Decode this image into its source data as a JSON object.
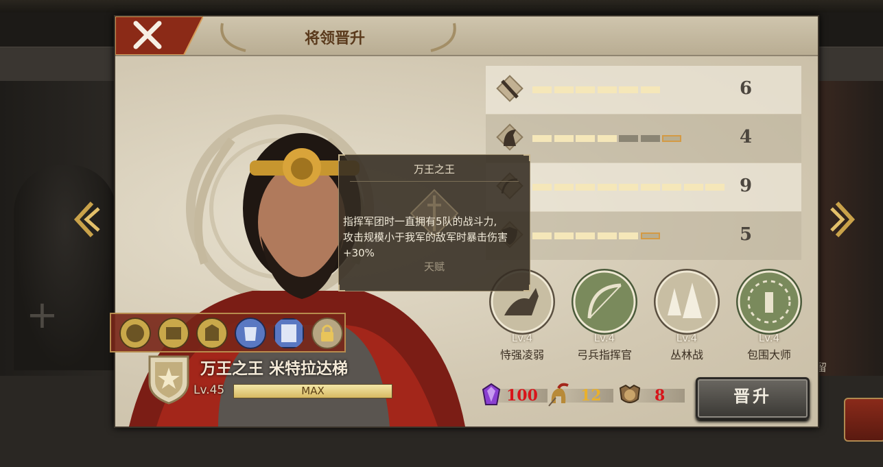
{
  "background": {
    "side_label_right": "留"
  },
  "dialog": {
    "title": "将领晋升",
    "close_icon": "close-x-icon"
  },
  "hero": {
    "name": "万王之王 米特拉达梯",
    "level": "Lv.45",
    "level_bar": "MAX",
    "rank_icon": "star-shield-icon"
  },
  "tooltip": {
    "title": "万王之王",
    "description_lines": [
      "指挥军团时一直拥有5队的战斗力,",
      "攻击规模小于我军的敌军时暴击伤害",
      "+30%"
    ],
    "footer": "天赋"
  },
  "stats": [
    {
      "icon": "sword-icon",
      "value": "6",
      "filled": 6,
      "max": 6,
      "next": false
    },
    {
      "icon": "horse-head-icon",
      "value": "4",
      "filled": 4,
      "max": 7,
      "next": true
    },
    {
      "icon": "bow-icon",
      "value": "9",
      "filled": 9,
      "max": 9,
      "next": false
    },
    {
      "icon": "shield-icon",
      "value": "5",
      "filled": 5,
      "max": 6,
      "next": true
    }
  ],
  "skills": [
    {
      "icon": "cavalry-rider-icon",
      "level": "Lv.4",
      "name": "恃强凌弱"
    },
    {
      "icon": "longbow-icon",
      "level": "Lv.4",
      "name": "弓兵指挥官"
    },
    {
      "icon": "forest-icon",
      "level": "Lv.4",
      "name": "丛林战"
    },
    {
      "icon": "encircle-soldiers-icon",
      "level": "Lv.4",
      "name": "包围大师"
    }
  ],
  "badges": [
    "helmet-badge-icon",
    "fortress-badge-icon",
    "gate-badge-icon",
    "armor-badge-icon",
    "banner-badge-icon",
    "lock-icon"
  ],
  "costs": [
    {
      "icon": "purple-gem-icon",
      "value": "100",
      "color": "#d8141a"
    },
    {
      "icon": "spartan-helmet-icon",
      "value": "12",
      "color": "#e9b12c"
    },
    {
      "icon": "lion-medal-icon",
      "value": "8",
      "color": "#d8141a"
    }
  ],
  "promote_button": "晋升",
  "colors": {
    "panel": "#d9d1bd",
    "title_text": "#5a3a1c",
    "bar_on": "#f5e7b9",
    "bar_off": "#8b8574",
    "accent_red": "#8a2a1a"
  }
}
